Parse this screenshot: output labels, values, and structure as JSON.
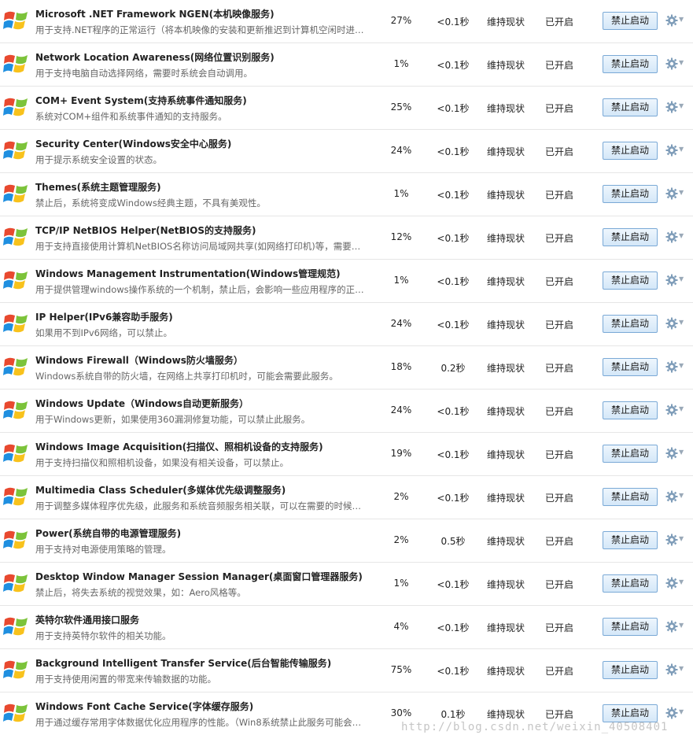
{
  "services": [
    {
      "title": "Microsoft .NET Framework NGEN(本机映像服务)",
      "desc": "用于支持.NET程序的正常运行（将本机映像的安装和更新推迟到计算机空闲时进…",
      "percent": "27%",
      "time": "<0.1秒",
      "recommend": "维持现状",
      "status": "已开启",
      "action": "禁止启动"
    },
    {
      "title": "Network Location Awareness(网络位置识别服务)",
      "desc": "用于支持电脑自动选择网络，需要时系统会自动调用。",
      "percent": "1%",
      "time": "<0.1秒",
      "recommend": "维持现状",
      "status": "已开启",
      "action": "禁止启动"
    },
    {
      "title": "COM+ Event System(支持系统事件通知服务)",
      "desc": "系统对COM+组件和系统事件通知的支持服务。",
      "percent": "25%",
      "time": "<0.1秒",
      "recommend": "维持现状",
      "status": "已开启",
      "action": "禁止启动"
    },
    {
      "title": "Security Center(Windows安全中心服务)",
      "desc": "用于提示系统安全设置的状态。",
      "percent": "24%",
      "time": "<0.1秒",
      "recommend": "维持现状",
      "status": "已开启",
      "action": "禁止启动"
    },
    {
      "title": "Themes(系统主题管理服务)",
      "desc": "禁止后，系统将变成Windows经典主题，不具有美观性。",
      "percent": "1%",
      "time": "<0.1秒",
      "recommend": "维持现状",
      "status": "已开启",
      "action": "禁止启动"
    },
    {
      "title": "TCP/IP NetBIOS Helper(NetBIOS的支持服务)",
      "desc": "用于支持直接使用计算机NetBIOS名称访问局域网共享(如网络打印机)等，需要…",
      "percent": "12%",
      "time": "<0.1秒",
      "recommend": "维持现状",
      "status": "已开启",
      "action": "禁止启动"
    },
    {
      "title": "Windows Management Instrumentation(Windows管理规范)",
      "desc": "用于提供管理windows操作系统的一个机制，禁止后，会影响一些应用程序的正…",
      "percent": "1%",
      "time": "<0.1秒",
      "recommend": "维持现状",
      "status": "已开启",
      "action": "禁止启动"
    },
    {
      "title": "IP Helper(IPv6兼容助手服务)",
      "desc": "如果用不到IPv6网络，可以禁止。",
      "percent": "24%",
      "time": "<0.1秒",
      "recommend": "维持现状",
      "status": "已开启",
      "action": "禁止启动"
    },
    {
      "title": "Windows Firewall（Windows防火墙服务）",
      "desc": "Windows系统自带的防火墙，在网络上共享打印机时，可能会需要此服务。",
      "percent": "18%",
      "time": "0.2秒",
      "recommend": "维持现状",
      "status": "已开启",
      "action": "禁止启动"
    },
    {
      "title": "Windows Update（Windows自动更新服务）",
      "desc": "用于Windows更新，如果使用360漏洞修复功能，可以禁止此服务。",
      "percent": "24%",
      "time": "<0.1秒",
      "recommend": "维持现状",
      "status": "已开启",
      "action": "禁止启动"
    },
    {
      "title": "Windows Image Acquisition(扫描仪、照相机设备的支持服务)",
      "desc": "用于支持扫描仪和照相机设备，如果没有相关设备，可以禁止。",
      "percent": "19%",
      "time": "<0.1秒",
      "recommend": "维持现状",
      "status": "已开启",
      "action": "禁止启动"
    },
    {
      "title": "Multimedia Class Scheduler(多媒体优先级调整服务)",
      "desc": "用于调整多媒体程序优先级，此服务和系统音频服务相关联，可以在需要的时候…",
      "percent": "2%",
      "time": "<0.1秒",
      "recommend": "维持现状",
      "status": "已开启",
      "action": "禁止启动"
    },
    {
      "title": "Power(系统自带的电源管理服务)",
      "desc": "用于支持对电源使用策略的管理。",
      "percent": "2%",
      "time": "0.5秒",
      "recommend": "维持现状",
      "status": "已开启",
      "action": "禁止启动"
    },
    {
      "title": "Desktop Window Manager Session Manager(桌面窗口管理器服务)",
      "desc": "禁止后，将失去系统的视觉效果，如：Aero风格等。",
      "percent": "1%",
      "time": "<0.1秒",
      "recommend": "维持现状",
      "status": "已开启",
      "action": "禁止启动"
    },
    {
      "title": "英特尔软件通用接口服务",
      "desc": "用于支持英特尔软件的相关功能。",
      "percent": "4%",
      "time": "<0.1秒",
      "recommend": "维持现状",
      "status": "已开启",
      "action": "禁止启动"
    },
    {
      "title": "Background Intelligent Transfer Service(后台智能传输服务)",
      "desc": "用于支持使用闲置的带宽来传输数据的功能。",
      "percent": "75%",
      "time": "<0.1秒",
      "recommend": "维持现状",
      "status": "已开启",
      "action": "禁止启动"
    },
    {
      "title": "Windows Font Cache Service(字体缓存服务)",
      "desc": "用于通过缓存常用字体数据优化应用程序的性能。（Win8系统禁止此服务可能会…",
      "percent": "30%",
      "time": "0.1秒",
      "recommend": "维持现状",
      "status": "已开启",
      "action": "禁止启动"
    }
  ],
  "watermark": "http://blog.csdn.net/weixin_40508401",
  "colors": {
    "button_border": "#7aa9d6",
    "button_bg": "#d4e7f8",
    "desc_text": "#666666",
    "gear": "#7f9db9"
  },
  "icons": {
    "row_icon": "windows-logo-icon",
    "settings": "gear-icon"
  }
}
